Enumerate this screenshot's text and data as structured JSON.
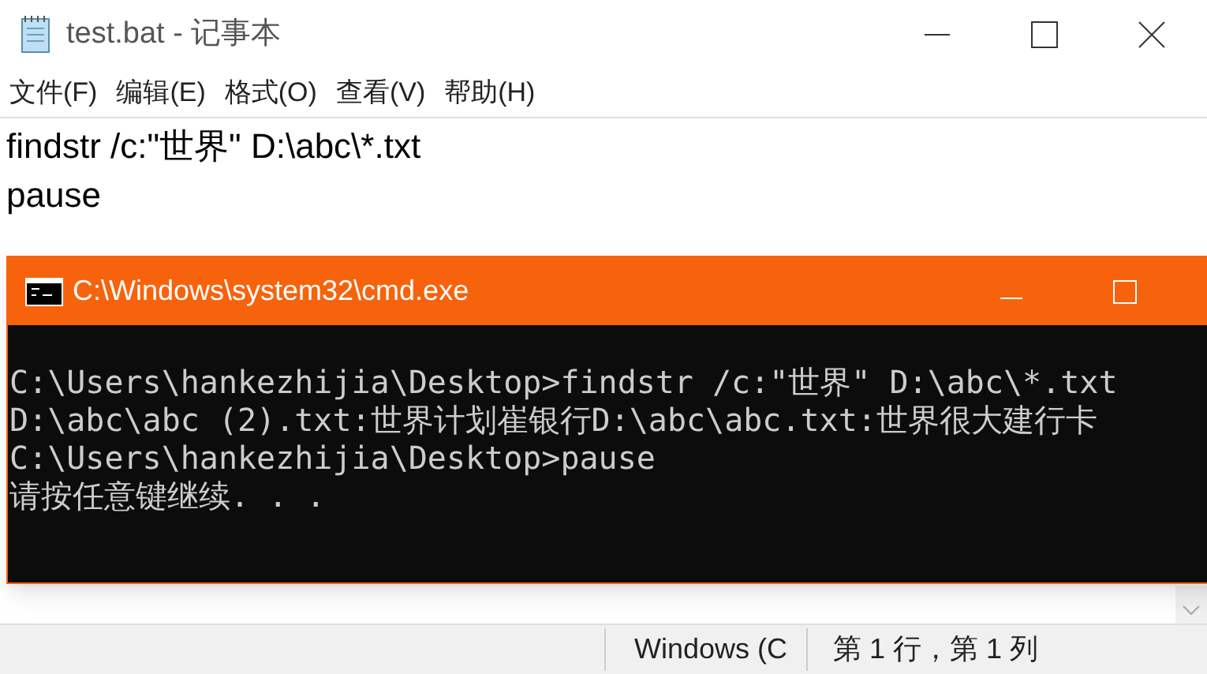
{
  "notepad": {
    "title": "test.bat - 记事本",
    "menu": [
      "文件(F)",
      "编辑(E)",
      "格式(O)",
      "查看(V)",
      "帮助(H)"
    ],
    "lines": [
      "findstr /c:\"世界\" D:\\abc\\*.txt",
      "pause"
    ],
    "status_bar": [
      "Windows (C",
      "第 1 行，第 1 列"
    ]
  },
  "cmd": {
    "title": "C:\\Windows\\system32\\cmd.exe",
    "lines": [
      "C:\\Users\\hankezhijia\\Desktop>findstr /c:\"世界\" D:\\abc\\*.txt",
      "D:\\abc\\abc (2).txt:世界计划崔银行D:\\abc\\abc.txt:世界很大建行卡",
      "C:\\Users\\hankezhijia\\Desktop>pause",
      "请按任意键继续. . ."
    ]
  }
}
